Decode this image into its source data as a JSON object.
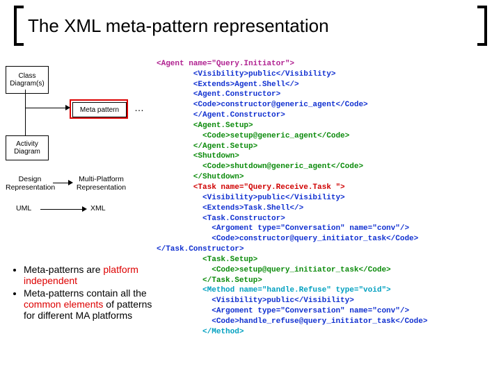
{
  "title": "The XML meta-pattern representation",
  "diagram": {
    "class_box": "Class\nDiagram(s)",
    "meta_box": "Meta pattern",
    "activity_box": "Activity\nDiagram",
    "design_label": "Design\nRepresentation",
    "multi_label": "Multi-Platform\nRepresentation",
    "uml_label": "UML",
    "xml_label": "XML",
    "dots": "…"
  },
  "bullets": {
    "b1a": "Meta-patterns are ",
    "b1b": "platform independent",
    "b2a": "Meta-patterns contain all the ",
    "b2b": "common elements",
    "b2c": " of patterns for different MA platforms"
  },
  "xml": {
    "l01": "<Agent name=\"Query.Initiator\">",
    "l02": "        <Visibility>public</Visibility>",
    "l03": "        <Extends>Agent.Shell</>",
    "l04": "        <Agent.Constructor>",
    "l05": "        <Code>constructor@generic_agent</Code>",
    "l06": "        </Agent.Constructor>",
    "l07": "        <Agent.Setup>",
    "l08": "          <Code>setup@generic_agent</Code>",
    "l09": "        </Agent.Setup>",
    "l10": "        <Shutdown>",
    "l11": "          <Code>shutdown@generic_agent</Code>",
    "l12": "        </Shutdown>",
    "l13": "        <Task name=\"Query.Receive.Task \">",
    "l14": "          <Visibility>public</Visibility>",
    "l15": "          <Extends>Task.Shell</>",
    "l16": "          <Task.Constructor>",
    "l17": "            <Argoment type=\"Conversation\" name=\"conv\"/>",
    "l18": "            <Code>constructor@query_initiator_task</Code>",
    "l19": "</Task.Constructor>",
    "l20": "          <Task.Setup>",
    "l21": "            <Code>setup@query_initiator_task</Code>",
    "l22": "          </Task.Setup>",
    "l23": "          <Method name=\"handle.Refuse\" type=\"void\">",
    "l24": "            <Visibility>public</Visibility>",
    "l25": "            <Argoment type=\"Conversation\" name=\"conv\"/>",
    "l26": "            <Code>handle_refuse@query_initiator_task</Code>",
    "l27": "          </Method>"
  }
}
